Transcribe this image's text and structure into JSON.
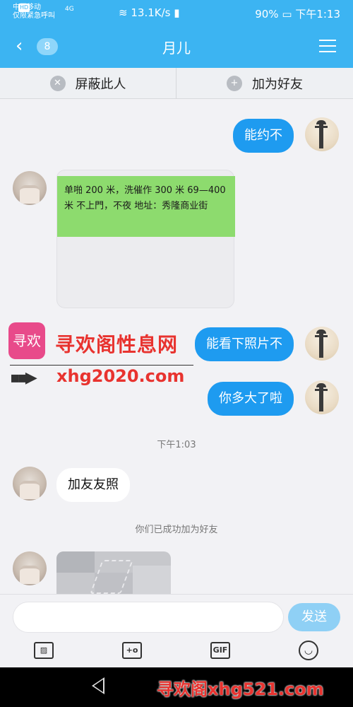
{
  "status": {
    "carrier": "中国移动",
    "carrier_badge": "HD",
    "emergency": "仅限紧急呼叫",
    "network": "4G",
    "speed": "13.1K/s",
    "battery": "90%",
    "time": "下午1:13"
  },
  "header": {
    "back_count": "8",
    "title": "月儿"
  },
  "actions": {
    "block": "屏蔽此人",
    "add_friend": "加为好友"
  },
  "messages": {
    "m1": "能约不",
    "card_note": "单啪 200 米，洗催作 300 米 69—400 米  不上門，不夜  地址：秀隆商业街",
    "m2": "能看下照片不",
    "m3": "你多大了啦",
    "time1": "下午1:03",
    "m4": "加友友照",
    "system": "你们已成功加为好友"
  },
  "input": {
    "placeholder": "",
    "send": "发送"
  },
  "tools": {
    "gif": "GIF"
  },
  "watermarks": {
    "logo": "寻欢",
    "site_name": "寻欢阁性息网",
    "site_url": "xhg2020.com",
    "bottom": "寻欢阁xhg521.com"
  },
  "colors": {
    "accent": "#3cb4f2",
    "outgoing_bubble": "#1e9bf0",
    "note": "#8ddb6e",
    "watermark": "#e8332f"
  }
}
